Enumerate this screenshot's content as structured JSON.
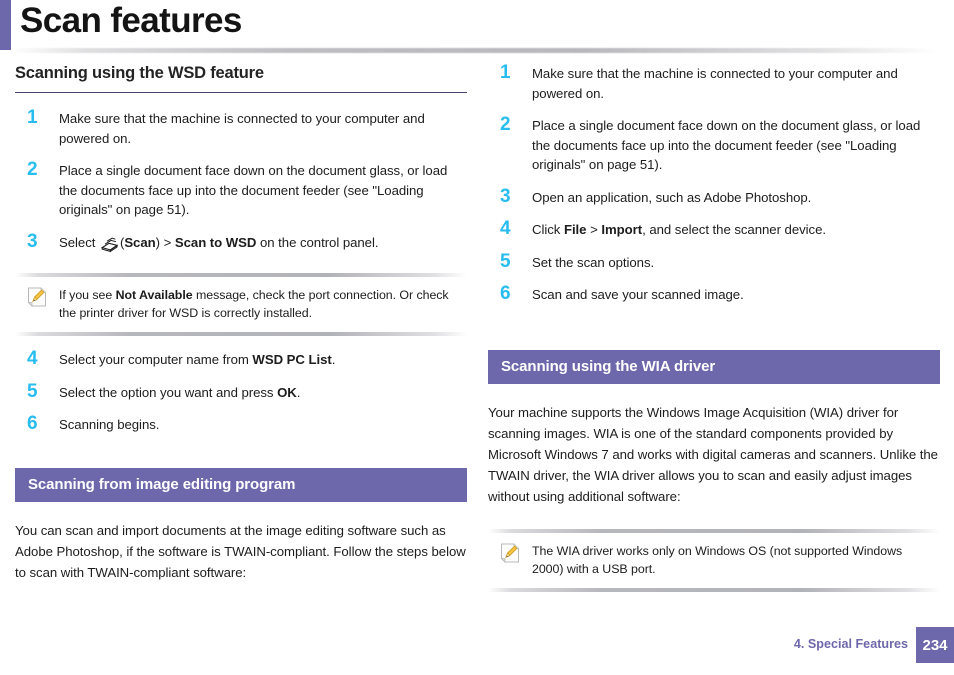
{
  "header": {
    "title": "Scan features"
  },
  "left_column": {
    "heading": "Scanning using the WSD feature",
    "steps": [
      {
        "num": "1",
        "text": "Make sure that the machine is connected to your computer and powered on."
      },
      {
        "num": "2",
        "text": "Place a single document face down on the document glass, or load the documents face up into the document feeder (see \"Loading originals\" on page 51)."
      },
      {
        "num": "3",
        "text_pre": "Select ",
        "icon": "scanner-icon",
        "text_post_a": "(",
        "bold_a": "Scan",
        "text_post_b": ") > ",
        "bold_b": "Scan to WSD",
        "text_post_c": " on the control panel."
      }
    ],
    "note": {
      "icon": "note-pencil-icon",
      "text_a": "If you see ",
      "bold_a": "Not Available",
      "text_b": " message, check the port connection. Or check the printer driver for WSD is correctly installed."
    },
    "steps_after": [
      {
        "num": "4",
        "text_a": "Select your computer name from ",
        "bold": "WSD PC List",
        "text_b": "."
      },
      {
        "num": "5",
        "text_a": "Select the option you want and press ",
        "bold": "OK",
        "text_b": "."
      },
      {
        "num": "6",
        "text_a": "Scanning begins.",
        "bold": "",
        "text_b": ""
      }
    ],
    "section2": {
      "heading": "Scanning from image editing program",
      "body": "You can scan and import documents at the image editing software such as Adobe Photoshop, if the software is TWAIN-compliant. Follow the steps below to scan with TWAIN-compliant software:"
    }
  },
  "right_column": {
    "steps": [
      {
        "num": "1",
        "text": "Make sure that the machine is connected to your computer and powered on."
      },
      {
        "num": "2",
        "text": "Place a single document face down on the document glass, or load the documents face up into the document feeder (see \"Loading originals\" on page 51)."
      },
      {
        "num": "3",
        "text": "Open an application, such as Adobe Photoshop."
      },
      {
        "num": "4",
        "text_a": "Click ",
        "bold_a": "File",
        "text_b": " > ",
        "bold_b": "Import",
        "text_c": ", and select the scanner device."
      },
      {
        "num": "5",
        "text": "Set the scan options."
      },
      {
        "num": "6",
        "text": "Scan and save your scanned image."
      }
    ],
    "section": {
      "heading": "Scanning using the WIA driver",
      "body": "Your machine supports the Windows Image Acquisition (WIA) driver for scanning images. WIA is one of the standard components provided by Microsoft Windows 7 and works with digital cameras and scanners. Unlike the TWAIN driver, the WIA driver allows you to scan and easily adjust images without using additional software:"
    },
    "note": {
      "icon": "note-pencil-icon",
      "text": "The WIA driver works only on Windows OS (not supported Windows 2000) with a USB port."
    }
  },
  "footer": {
    "chapter": "4.  Special Features",
    "page": "234"
  },
  "colors": {
    "purple": "#6d68ab",
    "cyan": "#29bdef",
    "heading_rule": "#4b4468",
    "text": "#1d1d1d"
  }
}
